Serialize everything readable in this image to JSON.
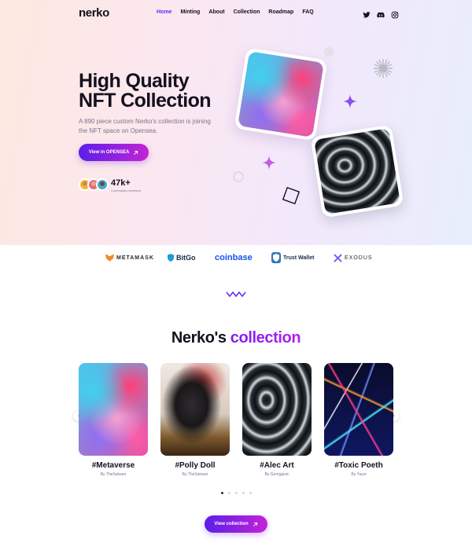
{
  "header": {
    "logo": "nerko",
    "nav": [
      "Home",
      "Minting",
      "About",
      "Collection",
      "Roadmap",
      "FAQ"
    ],
    "active_nav": "Home",
    "social_icons": [
      "twitter-icon",
      "discord-icon",
      "instagram-icon"
    ]
  },
  "hero": {
    "title_line1": "High Quality",
    "title_line2": "NFT Collection",
    "description": "A 890 piece custom Nerko's collection is joining the NFT space on Opensea.",
    "cta_label": "View in OPENSEA",
    "community_count": "47k+",
    "community_label": "Community members"
  },
  "partners": [
    "METAMASK",
    "BitGo",
    "coinbase",
    "Trust Wallet",
    "EXODUS"
  ],
  "collection": {
    "title_part1": "Nerko's",
    "title_part2": "collection",
    "items": [
      {
        "title": "#Metaverse",
        "author": "By TheSalvare"
      },
      {
        "title": "#Polly Doll",
        "author": "By TheSalvare"
      },
      {
        "title": "#Alec Art",
        "author": "By Georgjavic"
      },
      {
        "title": "#Toxic Poeth",
        "author": "By Yayoi"
      }
    ],
    "view_label": "View collection"
  },
  "colors": {
    "accent": "#6a2cf2",
    "gradient_start": "#5a1fe8",
    "gradient_end": "#c423d6"
  }
}
